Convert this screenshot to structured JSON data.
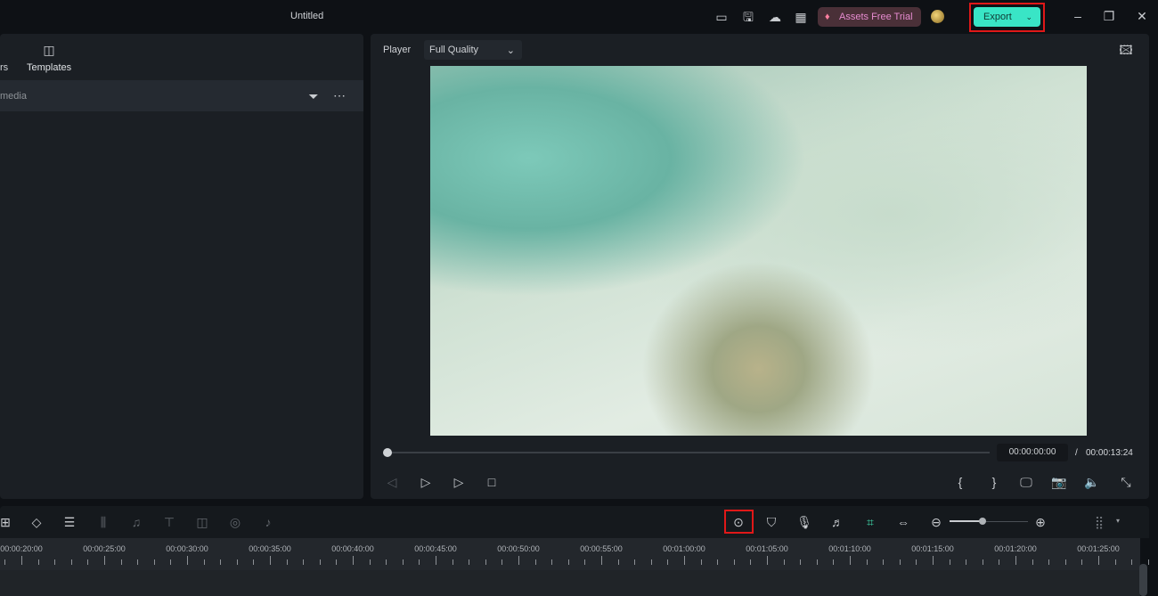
{
  "titlebar": {
    "title": "Untitled",
    "assets_label": "Assets Free Trial",
    "export_label": "Export",
    "icons": [
      "layout-icon",
      "save-icon",
      "cloud-upload-icon",
      "apps-icon",
      "gem-icon",
      "avatar",
      "minimize-icon",
      "restore-icon",
      "close-icon"
    ]
  },
  "left_panel": {
    "tab_partial": "rs",
    "tab_templates": "Templates",
    "media_partial": "media"
  },
  "player": {
    "label": "Player",
    "quality": "Full Quality",
    "current_time": "00:00:00:00",
    "separator": "/",
    "total_time": "00:00:13:24",
    "progress": 0
  },
  "timeline": {
    "ruler_labels": [
      "00:00:20:00",
      "00:00:25:00",
      "00:00:30:00",
      "00:00:35:00",
      "00:00:40:00",
      "00:00:45:00",
      "00:00:50:00",
      "00:00:55:00",
      "00:01:00:00",
      "00:01:05:00",
      "00:01:10:00",
      "00:01:15:00",
      "00:01:20:00",
      "00:01:25:00"
    ],
    "zoom_level": 0.4
  },
  "colors": {
    "accent": "#39e5c6",
    "highlight": "#e01818",
    "assets": "#e68bd0"
  }
}
